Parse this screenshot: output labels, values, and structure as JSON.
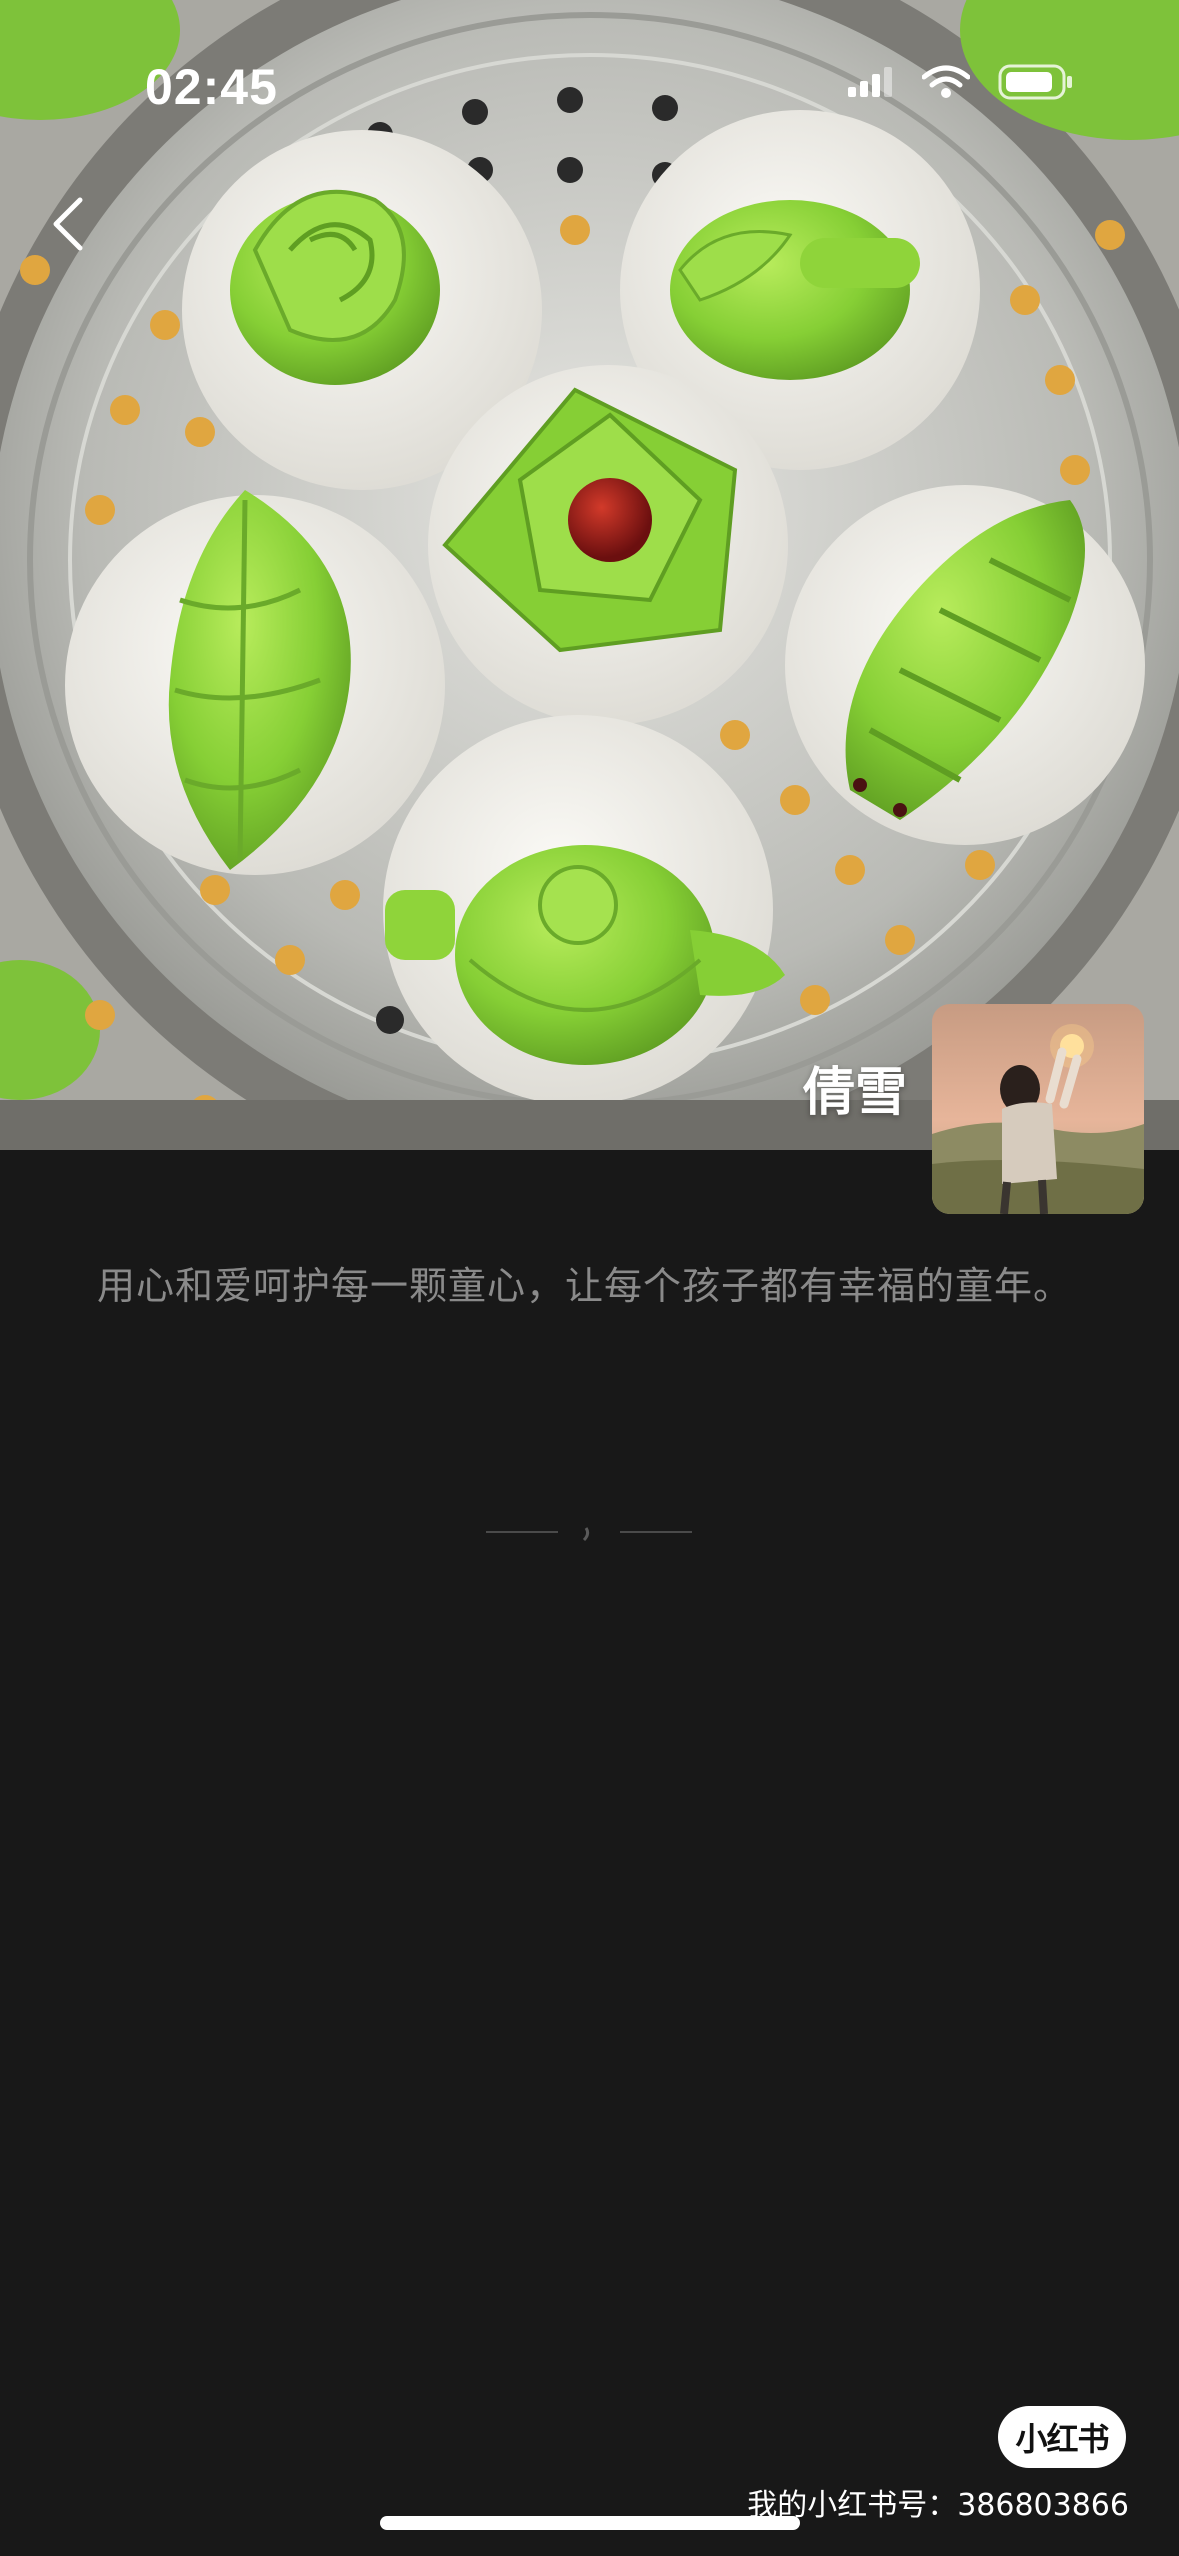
{
  "status_bar": {
    "time": "02:45",
    "icons": [
      "cellular-signal-icon",
      "wifi-icon",
      "battery-icon"
    ]
  },
  "navigation": {
    "back_icon": "chevron-left-icon"
  },
  "hero_photo": {
    "subject": "steamed-buns-photo",
    "colors": {
      "dough_green": "#8fd43a",
      "paper_white": "#f1efe9",
      "steel": "#c7c8c4",
      "jujube_red": "#8e1a1a"
    }
  },
  "author": {
    "name": "倩雪",
    "avatar_icon": "author-avatar"
  },
  "post": {
    "tagline": "用心和爱呵护每一颗童心，让每个孩子都有幸福的童年。"
  },
  "footer": {
    "logo_text": "小红书",
    "account_line": "我的小红书号：386803866"
  },
  "theme": {
    "background": "#181818",
    "text_primary": "#ffffff",
    "text_muted": "#8a8a8a"
  }
}
